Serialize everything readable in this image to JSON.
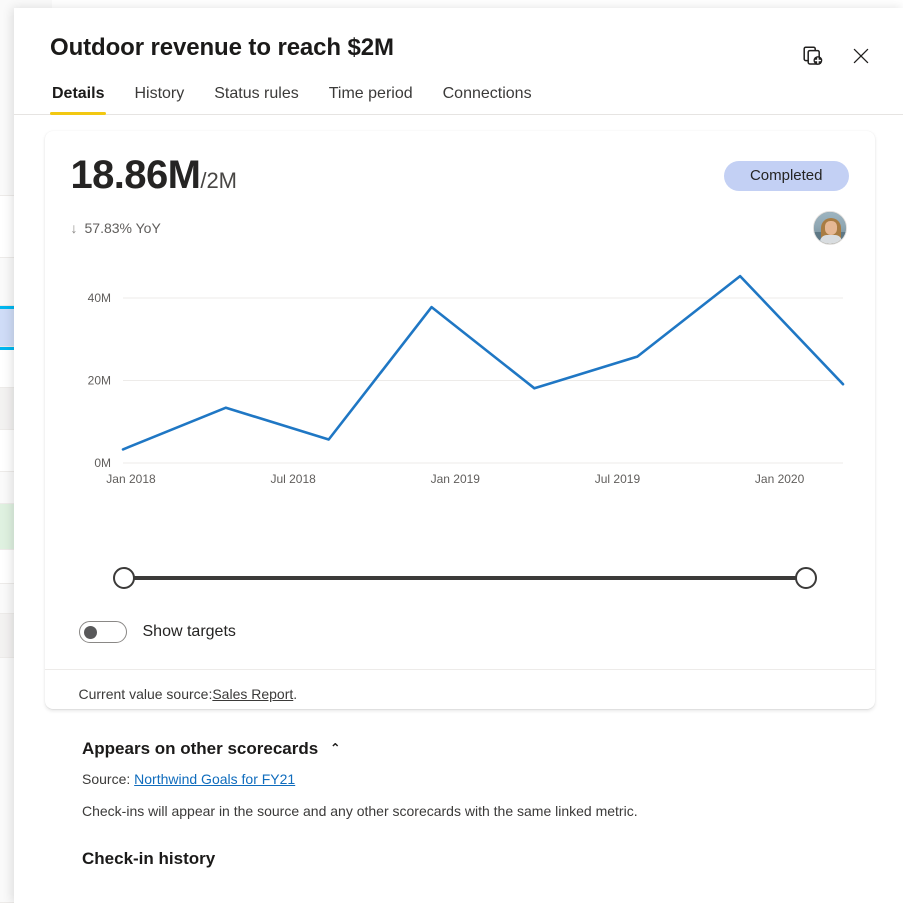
{
  "background_scorecard": {
    "description": "partially visible scorecard grid behind the panel",
    "accent_color": "#00b7f0",
    "selected_row_color": "#cfdcf7"
  },
  "header": {
    "title": "Outdoor revenue to reach $2M",
    "actions": [
      {
        "name": "add-to-scorecard-icon",
        "label": "Add to my scorecard"
      },
      {
        "name": "close-icon",
        "label": "Close"
      }
    ]
  },
  "tabs": [
    {
      "label": "Details",
      "active": true
    },
    {
      "label": "History",
      "active": false
    },
    {
      "label": "Status rules",
      "active": false
    },
    {
      "label": "Time period",
      "active": false
    },
    {
      "label": "Connections",
      "active": false
    }
  ],
  "metric_card": {
    "value": "18.86M",
    "target": "/2M",
    "status_badge": "Completed",
    "status_badge_color": "#c3d0f4",
    "trend_arrow": "↓",
    "trend_text": "57.83% YoY",
    "show_targets_label": "Show targets",
    "show_targets_on": false,
    "source_prefix": "Current value source:",
    "source_link": "Sales Report",
    "source_suffix": "."
  },
  "sections": {
    "appears_title": "Appears on other scorecards",
    "appears_chevron": "⌃",
    "appears_source_prefix": "Source:",
    "appears_source_link": "Northwind Goals for FY21",
    "appears_note": "Check-ins will appear in the source and any other scorecards with the same linked metric.",
    "checkin_title": "Check-in history"
  },
  "chart_data": {
    "type": "line",
    "title": "",
    "xlabel": "",
    "ylabel": "",
    "line_color": "#1f77c4",
    "grid": true,
    "legend": "none",
    "ylim": [
      0,
      48
    ],
    "yticks": [
      0,
      20,
      40
    ],
    "ytick_labels": [
      "0M",
      "20M",
      "40M"
    ],
    "xtick_labels": [
      "Jan 2018",
      "Jul 2018",
      "Jan 2019",
      "Jul 2019",
      "Jan 2020"
    ],
    "x": [
      0,
      1,
      2,
      3,
      4,
      5,
      6,
      7
    ],
    "values": [
      3.3,
      13.4,
      5.7,
      37.8,
      18.1,
      25.8,
      45.3,
      19.1
    ],
    "units": "millions"
  }
}
